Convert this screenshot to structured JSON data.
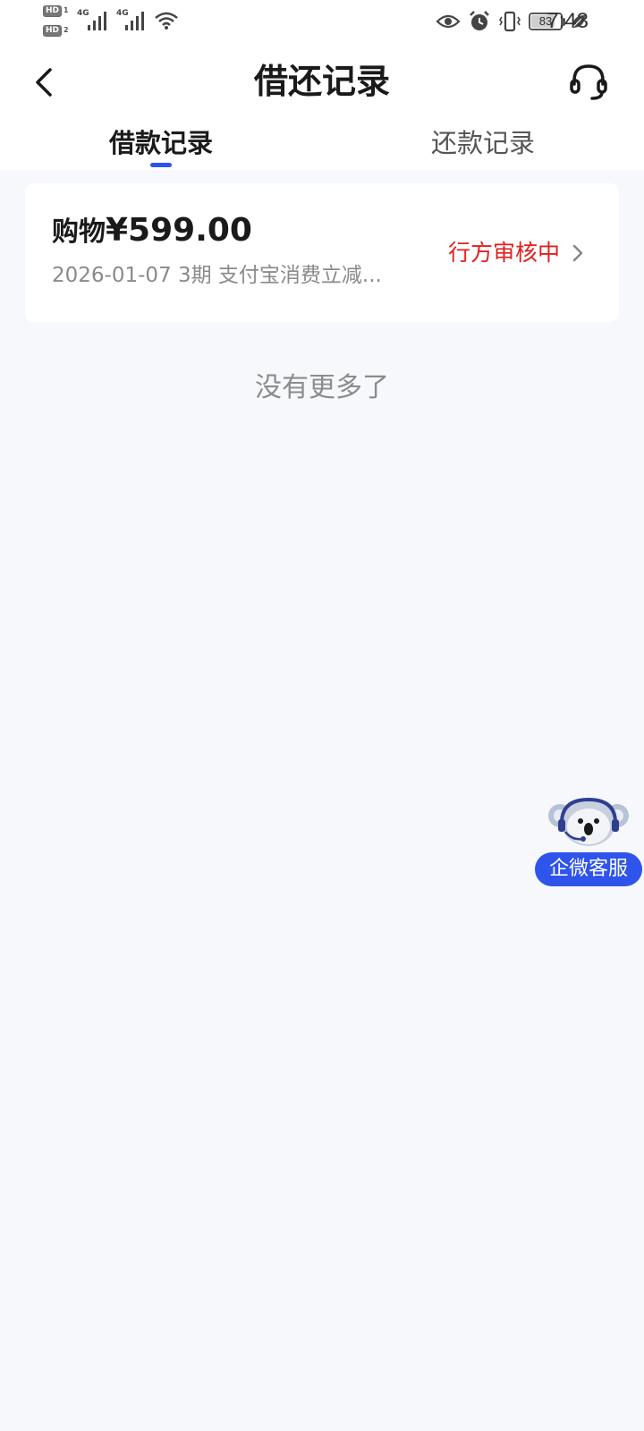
{
  "status_bar": {
    "sim1": "HD",
    "sim1_index": "1",
    "sim2": "HD",
    "sim2_index": "2",
    "network1": "4G",
    "network2": "4G",
    "battery_level": "83",
    "battery_fraction": 0.83,
    "time": "7:43"
  },
  "nav": {
    "title": "借还记录",
    "back_icon": "chevron-left-icon",
    "service_icon": "headset-icon"
  },
  "tabs": [
    {
      "label": "借款记录",
      "active": true
    },
    {
      "label": "还款记录",
      "active": false
    }
  ],
  "records": [
    {
      "category": "购物",
      "amount": "¥599.00",
      "subtitle": "2026-01-07 3期  支付宝消费立减...",
      "status": "行方审核中"
    }
  ],
  "footer_text": "没有更多了",
  "floating_service": {
    "label": "企微客服",
    "icon": "koala-headset-icon"
  },
  "colors": {
    "accent": "#2f54eb",
    "status_red": "#e02020",
    "background": "#f6f8fc",
    "muted_text": "#8a8a8a"
  }
}
